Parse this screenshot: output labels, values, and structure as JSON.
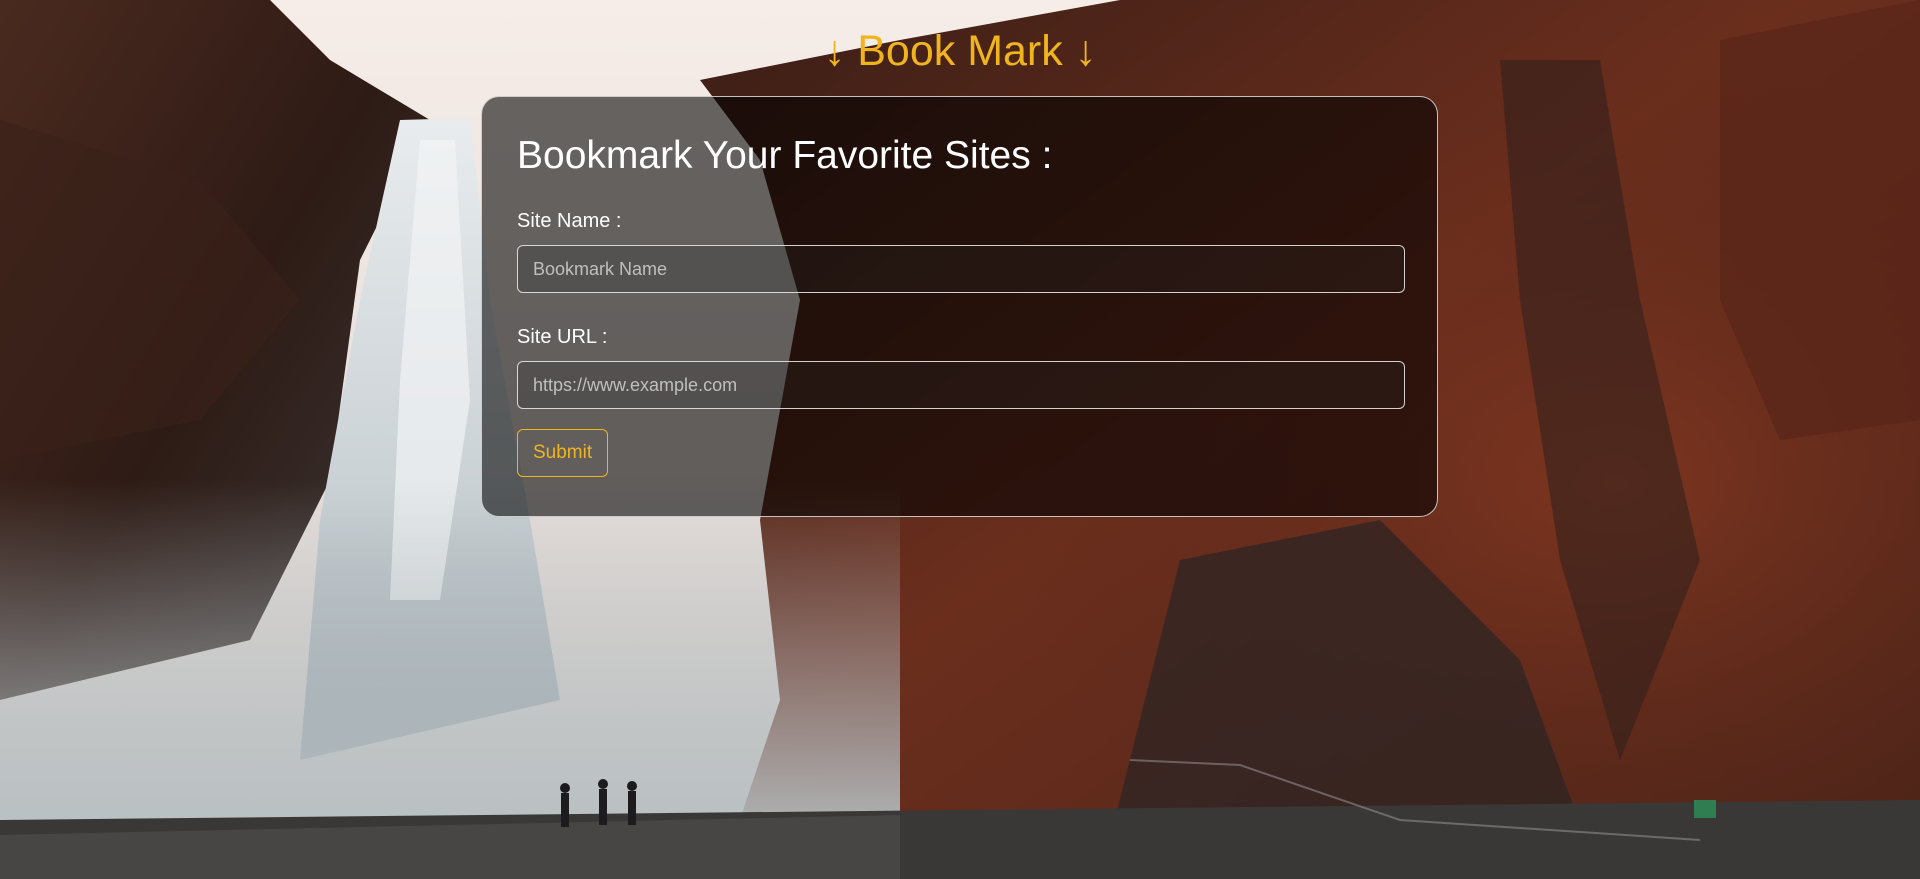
{
  "page": {
    "title": "↓ Book Mark ↓"
  },
  "form": {
    "heading": "Bookmark Your Favorite Sites :",
    "site_name_label": "Site Name :",
    "site_name_placeholder": "Bookmark Name",
    "site_name_value": "",
    "site_url_label": "Site URL :",
    "site_url_placeholder": "https://www.example.com",
    "site_url_value": "",
    "submit_label": "Submit"
  },
  "colors": {
    "accent": "#f0b41e",
    "card_background": "rgba(0,0,0,0.58)",
    "text": "#ffffff"
  },
  "background": {
    "description_icon": "waterfall-landscape-photo"
  }
}
